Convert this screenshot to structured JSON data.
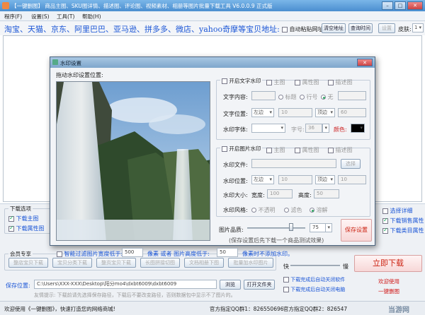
{
  "window": {
    "title": "【一键删图】 商品主图、SKU图详情、描述图、评论图、视频素材、相册等图片批量下载工具 V6.0.0.9 正式版",
    "menu": [
      "程序(F)",
      "设置(S)",
      "工具(T)",
      "帮助(H)"
    ]
  },
  "url_bar": {
    "title": "淘宝、天猫、京东、阿里巴巴、亚马逊、拼多多、微店、yahoo奇摩等宝贝地址:",
    "auto_paste": "自动粘贴网址",
    "clear_btn": "清空地址",
    "query_btn": "查询时间",
    "settings_btn": "设置",
    "skin_label": "皮肤:",
    "skin_value": "1"
  },
  "download_options": {
    "group_title": "下载选项",
    "main_image": "下载主图",
    "attr_image": "下载属性图",
    "right_col": [
      "选择详细",
      "下载销售属性",
      "下载类目属性"
    ]
  },
  "member": {
    "group_title": "会员专享",
    "buttons": [
      "整店宝贝下载",
      "宝贝分类下载",
      "整页宝贝下载",
      "长图拼接切图",
      "文档相册下图",
      "批量加水印图片"
    ]
  },
  "save": {
    "label": "保存位置:",
    "path": "C:\\Users\\XXX-XXX\\Desktop\\阳分mo4\\dxbt6009\\dxbt6009",
    "browse": "浏览",
    "open": "打开文件夹",
    "tip": "友情提示: 下载前请先选择保存路径，下载后不要改变路径，否则数据包中显示不了图片的。"
  },
  "right_panel": {
    "speed_label": "快",
    "speed_label2": "慢",
    "download_btn": "立即下载",
    "opt1": "下载完成后自动关闭软件",
    "opt2": "下载完成后自动关闭电脑",
    "welcome": "欢迎使用",
    "brand": "一键删图"
  },
  "status": {
    "left": "欢迎使用《一键删图》，快速打造您的网络商城!",
    "qq1": "官方指定QQ群1：826550696",
    "qq2": "官方指定QQ群2：826547",
    "brand_mark": "当游网"
  },
  "dialog": {
    "title": "水印设置",
    "drag_label": "拖动水印设置位置:",
    "text_wm": {
      "enable": "开启文字水印",
      "targets": [
        "主图",
        "属性图",
        "描述图"
      ],
      "content_label": "文字内容:",
      "content_opts": [
        "标题",
        "行号",
        "无"
      ],
      "pos_label": "文字位置:",
      "h_align": "左边",
      "h_val": "10",
      "v_align": "顶边",
      "v_val": "60",
      "font_label": "水印字体:",
      "size_label": "字号:",
      "size_val": "36",
      "color_label": "颜色:"
    },
    "img_wm": {
      "enable": "开启图片水印",
      "targets": [
        "主图",
        "属性图",
        "描述图"
      ],
      "file_label": "水印文件:",
      "select_btn": "选择",
      "pos_label": "水印位置:",
      "h_align": "左边",
      "h_val": "10",
      "v_align": "顶边",
      "v_val": "10",
      "size_label": "水印大小:",
      "width_label": "宽度:",
      "width_val": "100",
      "height_label": "高度:",
      "height_val": "50",
      "style_label": "水印风格:",
      "styles": [
        "不透明",
        "滤色",
        "溶解"
      ]
    },
    "quality": {
      "label": "图片品质:",
      "value": "75",
      "level": 0.75,
      "note": "(保存设置后先下载一个商品测试效果)",
      "save_btn": "保存设置"
    },
    "filter": {
      "label": "智能过滤图片宽度低于:",
      "width_val": "500",
      "unit1": "像素 或者 图片高度低于:",
      "height_val": "50",
      "unit2": "像素时不添加水印。"
    }
  },
  "colors": {
    "title_blue": "#1a55d6",
    "accent_red": "#d01818",
    "status_green": "#3a6"
  }
}
